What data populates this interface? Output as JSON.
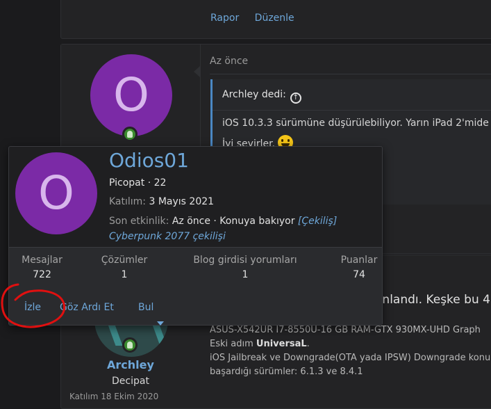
{
  "top_post": {
    "report_label": "Rapor",
    "edit_label": "Düzenle"
  },
  "post2": {
    "avatar_letter": "O",
    "time": "Az önce",
    "quote_author": "Archley dedi:",
    "quote_line1": "iOS 10.3.3 sürümüne düşürülebiliyor. Yarın iPad 2'mide",
    "quote_line2": "İyi seyirler."
  },
  "post3": {
    "author_name": "Archley",
    "author_title": "Decipat",
    "join_partial": "Katılım 18 Ekim 2020",
    "text_partial": "anlandı. Keşke bu 4",
    "signature": {
      "line1": "ASUS-X542UR I7-8550U-16 GB RAM-GTX 930MX-UHD Graph",
      "line2_prefix": "Eski adım ",
      "line2_bold": "UniversaL",
      "line2_suffix": ".",
      "line3": "iOS Jailbreak ve Downgrade(OTA yada IPSW) Downgrade konu",
      "line4": "başardığı sürümler: 6.1.3 ve 8.4.1"
    }
  },
  "member_card": {
    "avatar_letter": "O",
    "username": "Odios01",
    "title_line": "Picopat · 22",
    "join_label": "Katılım:",
    "join_date": "3 Mayıs 2021",
    "activity_label": "Son etkinlik:",
    "activity_time": "Az önce · Konuya bakıyor",
    "activity_link": "[Çekiliş] Cyberpunk 2077 çekilişi",
    "stats": [
      {
        "label": "Mesajlar",
        "value": "722"
      },
      {
        "label": "Çözümler",
        "value": "1"
      },
      {
        "label": "Blog girdisi yorumları",
        "value": "1"
      },
      {
        "label": "Puanlar",
        "value": "74"
      }
    ],
    "actions": {
      "watch": "İzle",
      "ignore": "Göz Ardı Et",
      "find": "Bul"
    }
  },
  "colors": {
    "link": "#6ea7d9",
    "avatar_purple": "#7b2aa6",
    "annotation_red": "#e01010"
  }
}
